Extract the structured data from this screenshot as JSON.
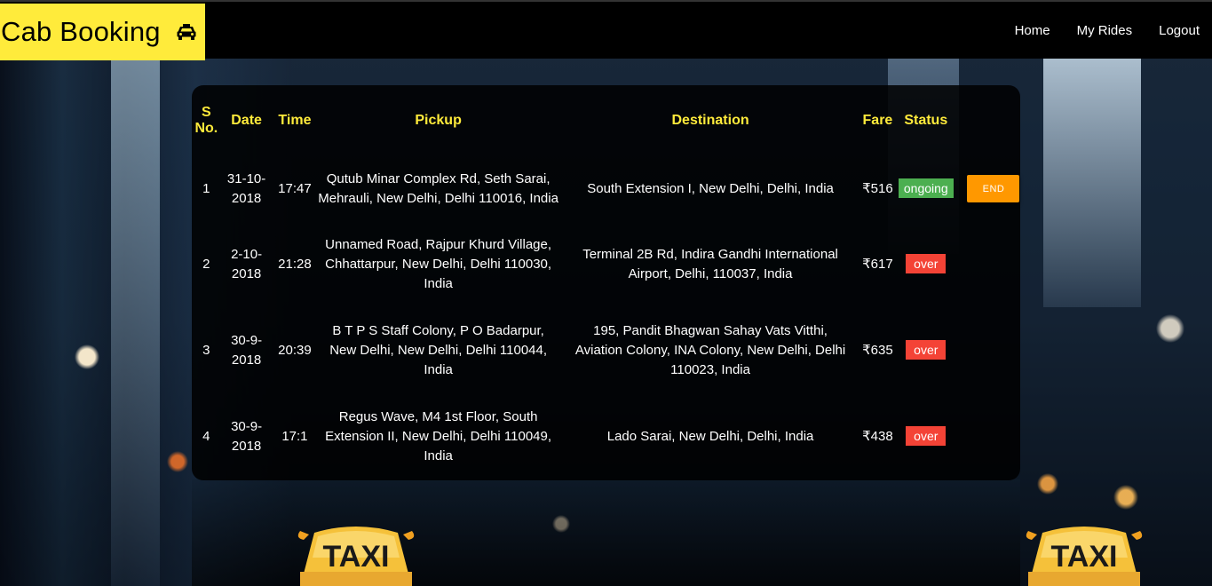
{
  "app": {
    "title": "Cab Booking",
    "icon": "taxi-icon",
    "accent_color": "#ffeb3b"
  },
  "nav": {
    "items": [
      {
        "label": "Home"
      },
      {
        "label": "My Rides"
      },
      {
        "label": "Logout"
      }
    ]
  },
  "rides": {
    "headers": {
      "sno": "S No.",
      "date": "Date",
      "time": "Time",
      "pickup": "Pickup",
      "destination": "Destination",
      "fare": "Fare",
      "status": "Status"
    },
    "rows": [
      {
        "sno": "1",
        "date": "31-10-2018",
        "time": "17:47",
        "pickup": "Qutub Minar Complex Rd, Seth Sarai, Mehrauli, New Delhi, Delhi 110016, India",
        "destination": "South Extension I, New Delhi, Delhi, India",
        "fare": "₹516",
        "status": "ongoing",
        "action": "END"
      },
      {
        "sno": "2",
        "date": "2-10-2018",
        "time": "21:28",
        "pickup": "Unnamed Road, Rajpur Khurd Village, Chhattarpur, New Delhi, Delhi 110030, India",
        "destination": "Terminal 2B Rd, Indira Gandhi International Airport, Delhi, 110037, India",
        "fare": "₹617",
        "status": "over"
      },
      {
        "sno": "3",
        "date": "30-9-2018",
        "time": "20:39",
        "pickup": "B T P S Staff Colony, P O Badarpur, New Delhi, New Delhi, Delhi 110044, India",
        "destination": "195, Pandit Bhagwan Sahay Vats Vitthi, Aviation Colony, INA Colony, New Delhi, Delhi 110023, India",
        "fare": "₹635",
        "status": "over"
      },
      {
        "sno": "4",
        "date": "30-9-2018",
        "time": "17:1",
        "pickup": "Regus Wave, M4 1st Floor, South Extension II, New Delhi, Delhi 110049, India",
        "destination": "Lado Sarai, New Delhi, Delhi, India",
        "fare": "₹438",
        "status": "over"
      }
    ],
    "status_colors": {
      "ongoing": "#4caf50",
      "over": "#f44336",
      "end_button": "#ff9800"
    }
  },
  "background": {
    "signs": [
      "TAXI",
      "TAXI"
    ]
  }
}
